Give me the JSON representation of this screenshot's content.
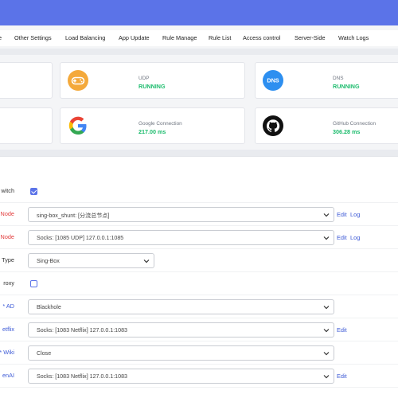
{
  "nav_tabs": [
    {
      "label": "e"
    },
    {
      "label": "Other Settings"
    },
    {
      "label": "Load Balancing"
    },
    {
      "label": "App Update"
    },
    {
      "label": "Rule Manage"
    },
    {
      "label": "Rule List"
    },
    {
      "label": "Access control"
    },
    {
      "label": "Server-Side"
    },
    {
      "label": "Watch Logs"
    }
  ],
  "status_cards": [
    {
      "title": "UDP",
      "value": "RUNNING",
      "icon": "gamepad-icon"
    },
    {
      "title": "DNS",
      "value": "RUNNING",
      "icon": "dns-icon",
      "icon_text": "DNS"
    },
    {
      "title": "Google Connection",
      "value": "217.00 ms",
      "icon": "google-icon",
      "icon_text": "G"
    },
    {
      "title": "GitHub Connection",
      "value": "306.28 ms",
      "icon": "github-icon"
    }
  ],
  "form_rows": [
    {
      "label": "witch",
      "type": "checkbox",
      "checked": true
    },
    {
      "label": "Node",
      "type": "select",
      "value": "sing-box_shunt: [分流总节点]",
      "links": [
        "Edit",
        "Log"
      ]
    },
    {
      "label": "Node",
      "type": "select",
      "value": "Socks: [1085 UDP] 127.0.0.1:1085",
      "links": [
        "Edit",
        "Log"
      ]
    },
    {
      "label": "Type",
      "type": "select",
      "value": "Sing-Box"
    },
    {
      "label": "roxy",
      "type": "checkbox",
      "checked": false
    },
    {
      "label": "* AD",
      "type": "select",
      "value": "Blackhole"
    },
    {
      "label": "etflix",
      "type": "select",
      "value": "Socks: [1083 Netflix] 127.0.0.1:1083",
      "links": [
        "Edit"
      ]
    },
    {
      "label": "* Wiki",
      "type": "select",
      "value": "Close"
    },
    {
      "label": "enAI",
      "type": "select",
      "value": "Socks: [1083 Netflix] 127.0.0.1:1083",
      "links": [
        "Edit"
      ]
    }
  ],
  "colors": {
    "accent": "#5b73e8",
    "running": "#1cbc6d",
    "node_label": "#e23b3b",
    "rule_label": "#3d5ad6",
    "gamepad": "#f4a93b",
    "dns_badge": "#2d8ff0"
  }
}
